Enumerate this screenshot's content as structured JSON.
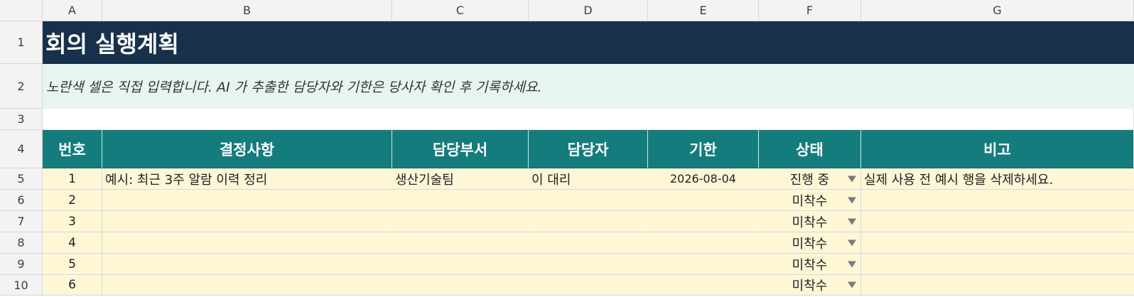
{
  "columns": [
    "A",
    "B",
    "C",
    "D",
    "E",
    "F",
    "G"
  ],
  "row_numbers": [
    "1",
    "2",
    "3",
    "4",
    "5",
    "6",
    "7",
    "8",
    "9",
    "10"
  ],
  "title": "회의 실행계획",
  "note": "노란색 셀은 직접 입력합니다. AI 가 추출한 담당자와 기한은 당사자 확인 후 기록하세요.",
  "table": {
    "headers": [
      "번호",
      "결정사항",
      "담당부서",
      "담당자",
      "기한",
      "상태",
      "비고"
    ],
    "rows": [
      {
        "no": "1",
        "decision": "예시: 최근 3주 알람 이력 정리",
        "dept": "생산기술팀",
        "person": "이 대리",
        "due": "2026-08-04",
        "status": "진행 중",
        "remark": "실제 사용 전 예시 행을 삭제하세요."
      },
      {
        "no": "2",
        "decision": "",
        "dept": "",
        "person": "",
        "due": "",
        "status": "미착수",
        "remark": ""
      },
      {
        "no": "3",
        "decision": "",
        "dept": "",
        "person": "",
        "due": "",
        "status": "미착수",
        "remark": ""
      },
      {
        "no": "4",
        "decision": "",
        "dept": "",
        "person": "",
        "due": "",
        "status": "미착수",
        "remark": ""
      },
      {
        "no": "5",
        "decision": "",
        "dept": "",
        "person": "",
        "due": "",
        "status": "미착수",
        "remark": ""
      },
      {
        "no": "6",
        "decision": "",
        "dept": "",
        "person": "",
        "due": "",
        "status": "미착수",
        "remark": ""
      }
    ]
  },
  "colors": {
    "title_bg": "#18314a",
    "header_bg": "#147c7c",
    "note_bg": "#e7f4f1",
    "input_bg": "#fff6d6"
  },
  "icons": {
    "dropdown": "triangle-down-icon"
  }
}
